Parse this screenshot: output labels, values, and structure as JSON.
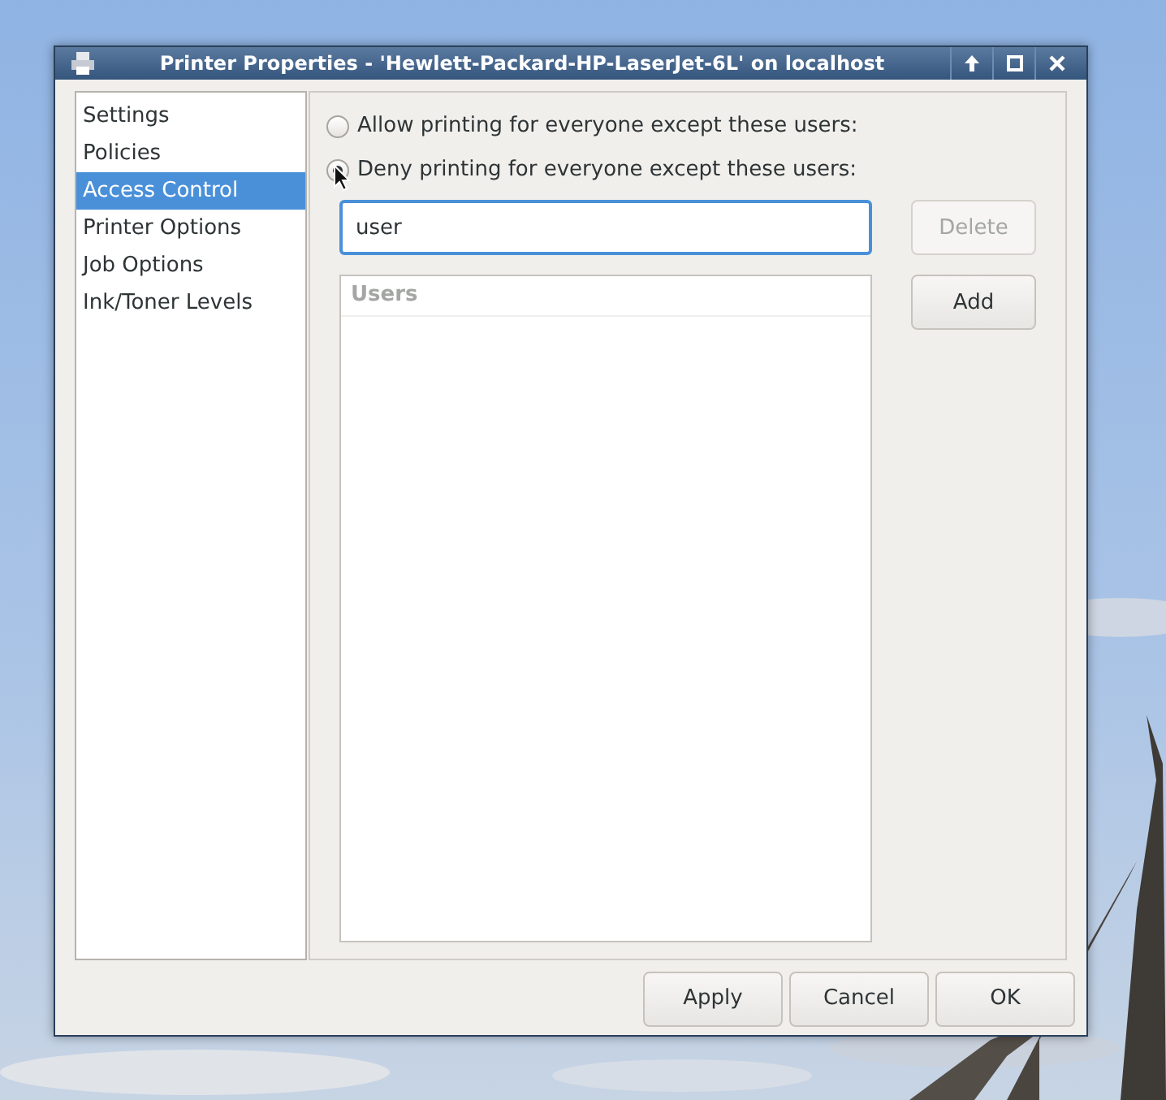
{
  "window": {
    "title": "Printer Properties - 'Hewlett-Packard-HP-LaserJet-6L' on localhost"
  },
  "sidebar": {
    "items": [
      {
        "label": "Settings",
        "selected": false
      },
      {
        "label": "Policies",
        "selected": false
      },
      {
        "label": "Access Control",
        "selected": true
      },
      {
        "label": "Printer Options",
        "selected": false
      },
      {
        "label": "Job Options",
        "selected": false
      },
      {
        "label": "Ink/Toner Levels",
        "selected": false
      }
    ]
  },
  "access_control": {
    "options": [
      {
        "label": "Allow printing for everyone except these users:",
        "selected": false
      },
      {
        "label": "Deny printing for everyone except these users:",
        "selected": true
      }
    ],
    "user_field": {
      "value": "user"
    },
    "users_list": {
      "header": "Users"
    },
    "buttons": [
      {
        "label": "Delete",
        "disabled": true
      },
      {
        "label": "Add",
        "disabled": false
      }
    ]
  },
  "buttons": [
    {
      "label": "Apply"
    },
    {
      "label": "Cancel"
    },
    {
      "label": "OK"
    }
  ]
}
